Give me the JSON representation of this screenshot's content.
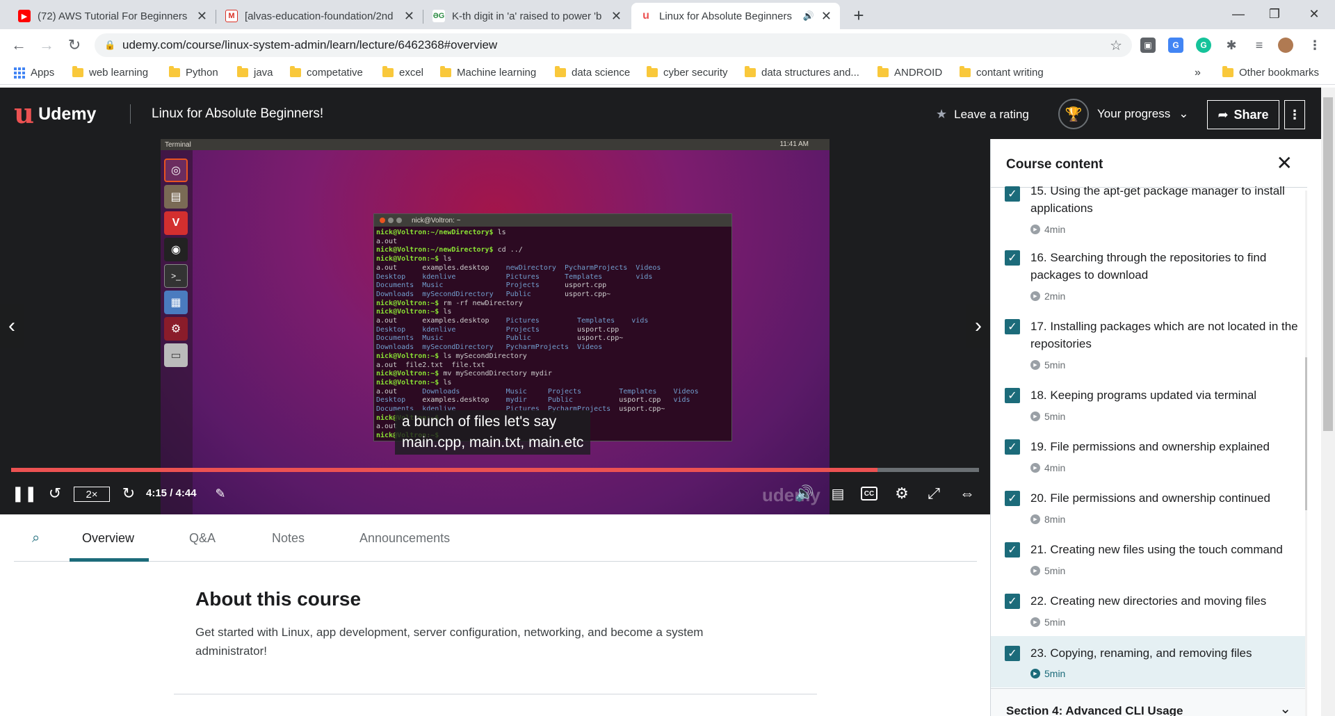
{
  "browser": {
    "tabs": [
      {
        "title": "(72) AWS Tutorial For Beginners |",
        "icon": "youtube-icon",
        "color": "#ff0000"
      },
      {
        "title": "[alvas-education-foundation/2nd",
        "icon": "gmail-icon",
        "color": "#d93025"
      },
      {
        "title": "K-th digit in 'a' raised to power 'b",
        "icon": "gfg-icon",
        "color": "#2f8d46"
      },
      {
        "title": "Linux for Absolute Beginners",
        "icon": "udemy-icon",
        "color": "#ec5252"
      }
    ],
    "url": "udemy.com/course/linux-system-admin/learn/lecture/6462368#overview",
    "bookmarks": [
      "Apps",
      "web learning",
      "Python",
      "java",
      "competative",
      "excel",
      "Machine learning",
      "data science",
      "cyber security",
      "data structures and...",
      "ANDROID",
      "contant writing"
    ],
    "other_bookmarks": "Other bookmarks",
    "overflow": "»"
  },
  "header": {
    "brand": "Udemy",
    "course_title": "Linux for Absolute Beginners!",
    "rating_label": "Leave a rating",
    "progress_label": "Your progress",
    "share_label": "Share"
  },
  "video": {
    "os_topbar_label": "Terminal",
    "os_clock": "11:41 AM",
    "terminal_title": "nick@Voltron: ~",
    "subtitle_line1": "a bunch of files let's say",
    "subtitle_line2": "main.cpp, main.txt, main.etc",
    "speed": "2×",
    "timecode": "4:15 / 4:44",
    "progress_fraction": 0.895,
    "watermark": "udemy"
  },
  "tabs": {
    "items": [
      "Overview",
      "Q&A",
      "Notes",
      "Announcements"
    ]
  },
  "about": {
    "heading": "About this course",
    "description": "Get started with Linux, app development, server configuration, networking, and become a system administrator!"
  },
  "sidebar": {
    "title": "Course content",
    "lectures": [
      {
        "title": "15. Using the apt-get package manager to install applications",
        "duration": "4min"
      },
      {
        "title": "16. Searching through the repositories to find packages to download",
        "duration": "2min"
      },
      {
        "title": "17. Installing packages which are not located in the repositories",
        "duration": "5min"
      },
      {
        "title": "18. Keeping programs updated via terminal",
        "duration": "5min"
      },
      {
        "title": "19. File permissions and ownership explained",
        "duration": "4min"
      },
      {
        "title": "20. File permissions and ownership continued",
        "duration": "8min"
      },
      {
        "title": "21. Creating new files using the touch command",
        "duration": "5min"
      },
      {
        "title": "22. Creating new directories and moving files",
        "duration": "5min"
      },
      {
        "title": "23. Copying, renaming, and removing files",
        "duration": "5min"
      }
    ],
    "section": "Section 4: Advanced CLI Usage"
  }
}
